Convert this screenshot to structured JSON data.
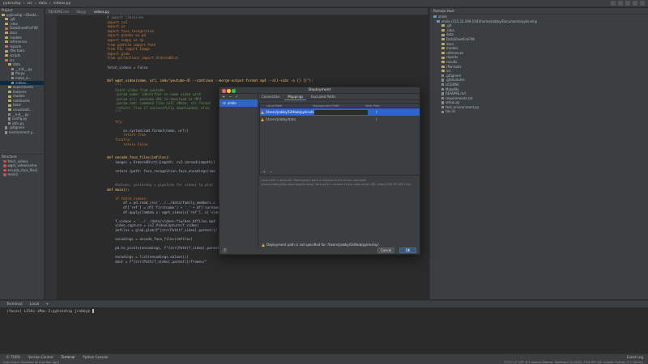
{
  "topbar": {
    "project": "pykinship",
    "breadcrumb": [
      "src",
      "data",
      "videos.py"
    ]
  },
  "project_panel": {
    "title": "Project",
    "items": [
      "pykinship ~/Deskt...",
      ".git",
      ".idea",
      "DataSheetForFIW",
      "docs",
      "models",
      "references",
      "reports",
      "rfiw-tools",
      "scripts",
      "src",
      "data",
      "__init__.py",
      "fiw.py",
      "make_d...",
      "videos...",
      "experiments",
      "features",
      "models",
      "notebooks",
      "tools",
      "visualizati...",
      "__init__.py",
      "config.py",
      "utils.py",
      ".gitignore",
      "environment.y..."
    ]
  },
  "structure_panel": {
    "title": "Structure",
    "items": [
      "fetch_videos",
      "wget_video(name,",
      "encode_face_files(",
      "main()"
    ]
  },
  "tabs": [
    "README.md",
    "fiw.py",
    "videos.py"
  ],
  "code": [
    {
      "t": "# import libraries",
      "c": "cm"
    },
    {
      "t": "import cv2",
      "c": "kw"
    },
    {
      "t": "import os",
      "c": "kw"
    },
    {
      "t": "import face_recognition",
      "c": "kw"
    },
    {
      "t": "import pandas as pd",
      "c": "kw"
    },
    {
      "t": "import numpy as np",
      "c": "kw"
    },
    {
      "t": "from pathlib import Path",
      "c": "kw"
    },
    {
      "t": "from PIL import Image",
      "c": "kw"
    },
    {
      "t": "import glob",
      "c": "kw"
    },
    {
      "t": "from collections import OrderedDict",
      "c": "kw"
    },
    {
      "t": "",
      "c": ""
    },
    {
      "t": "fetch_videos = False",
      "c": ""
    },
    {
      "t": "",
      "c": ""
    },
    {
      "t": "",
      "c": ""
    },
    {
      "t": "def wget_video(name, url, cmd=\"youtube-dl --continue --merge-output-format mp4 --all-subs -o {} {}\"):",
      "c": "fn"
    },
    {
      "t": "    \"\"\"",
      "c": "dc"
    },
    {
      "t": "    Fetch video from youtube",
      "c": "dc"
    },
    {
      "t": "    :param name: identifier to name video with",
      "c": "dc"
    },
    {
      "t": "    :param url: youtube URL to download as MP4",
      "c": "dc"
    },
    {
      "t": "    :param cmd: command line call (Note, str.format",
      "c": "dc"
    },
    {
      "t": "    :return: True if successfully downloaded; else,",
      "c": "dc"
    },
    {
      "t": "    \"\"\"",
      "c": "dc"
    },
    {
      "t": "",
      "c": ""
    },
    {
      "t": "    try:",
      "c": "kw"
    },
    {
      "t": "",
      "c": ""
    },
    {
      "t": "        os.system(cmd.format(name, url))",
      "c": ""
    },
    {
      "t": "        return True",
      "c": "kw"
    },
    {
      "t": "    finally:",
      "c": "kw"
    },
    {
      "t": "        return False",
      "c": "kw"
    },
    {
      "t": "",
      "c": ""
    },
    {
      "t": "",
      "c": ""
    },
    {
      "t": "def encode_face_files(imfiles):",
      "c": "fn"
    },
    {
      "t": "    images = OrderedDict({impath: cv2.imread(impath)[",
      "c": ""
    },
    {
      "t": "",
      "c": ""
    },
    {
      "t": "    return {path: face_recognition.face_encodings(ima",
      "c": ""
    },
    {
      "t": "",
      "c": ""
    },
    {
      "t": "",
      "c": ""
    },
    {
      "t": "    #values, yesterday = pipeline for videos to proc",
      "c": "cm"
    },
    {
      "t": "def main():",
      "c": "fn"
    },
    {
      "t": "",
      "c": ""
    },
    {
      "t": "    if fetch_videos:",
      "c": "kw"
    },
    {
      "t": "        df = pd.read_csv('../../data/family_members.c",
      "c": ""
    },
    {
      "t": "        df['ref'] = df['firstname'] + '_' + df['surname'",
      "c": ""
    },
    {
      "t": "        df.apply(lambda x: wget_video(x['ref'], x['video",
      "c": ""
    },
    {
      "t": "",
      "c": ""
    },
    {
      "t": "    f_videos = '../../data/videos-fiw/bes_bffiles.mp4'",
      "c": ""
    },
    {
      "t": "    video_capture = cv2.VideoCapture(f_video)",
      "c": ""
    },
    {
      "t": "    imfiles = glob.glob(f\"{str(Path(f_video).parent)}/",
      "c": ""
    },
    {
      "t": "",
      "c": ""
    },
    {
      "t": "    encodings = encode_face_files(imfiles)",
      "c": ""
    },
    {
      "t": "",
      "c": ""
    },
    {
      "t": "    pd.to_pickle(encodings, f\"{str(Path(f_video).parent)}/enc-encodings.pkl\")",
      "c": ""
    },
    {
      "t": "",
      "c": ""
    },
    {
      "t": "    encodings = list(encodings.values())",
      "c": ""
    },
    {
      "t": "    dout = f\"{str(Path(f_video).parent)}/frames/\"",
      "c": ""
    }
  ],
  "remote": {
    "title": "Remote Host",
    "server": "smile",
    "host_path": "smile (155.33.199.104)/home/jrobby/Documents/pykinship",
    "items": [
      ".git",
      ".idea",
      "data",
      "DataSheetForFIW",
      "docs",
      "models",
      "references",
      "reports",
      "results",
      "rfiw-tools",
      "src",
      ".gitignore",
      ".gitmodules",
      "LICENSE",
      "Makefile",
      "README.md",
      "requirements.txt",
      "setup.py",
      "test_environment.py",
      "tox.ini"
    ]
  },
  "dialog": {
    "title": "Deployment",
    "server": "smile",
    "tabs": [
      "Connection",
      "Mappings",
      "Excluded Paths"
    ],
    "columns": [
      "Local Path",
      "Deployment Path",
      "Web Path"
    ],
    "rows": [
      {
        "local": "/Users/jrobby/GitHub/pykinship",
        "deploy": "",
        "web": "/"
      },
      {
        "local": "/Users/jrobby/data",
        "deploy": "",
        "web": "/"
      }
    ],
    "hint": "Local path is absolute. Deployment path is relative to the server root path (/home/jrobby/Documents/pykinship). Web path is relative to the web server URL (http://155.33.199.104).",
    "warning": "Deployment path is not specified for '/Users/jrobby/GitHub/pykinship'.",
    "cancel": "Cancel",
    "ok": "OK",
    "help": "?"
  },
  "terminal": {
    "tabs": [
      "Terminal:",
      "Local"
    ],
    "prompt": "(faces) LISAs-iMac-2:pykinship jrobby$ "
  },
  "toolbar": [
    "6: TODO",
    "Version Control",
    "Terminal",
    "Python Console",
    "Event Log"
  ],
  "status": {
    "left": "Auto fetch: Finished (8 minutes ago)",
    "right": "373:1   LF   UTF-8   4 spaces   Blame: Robinson 5/14/20, 7:54 PM   Git: master   Python 3.7 (faces)"
  },
  "colors": {
    "accent": "#2f65ca",
    "warning": "#e6a23c",
    "folder": "#b8a86a"
  }
}
